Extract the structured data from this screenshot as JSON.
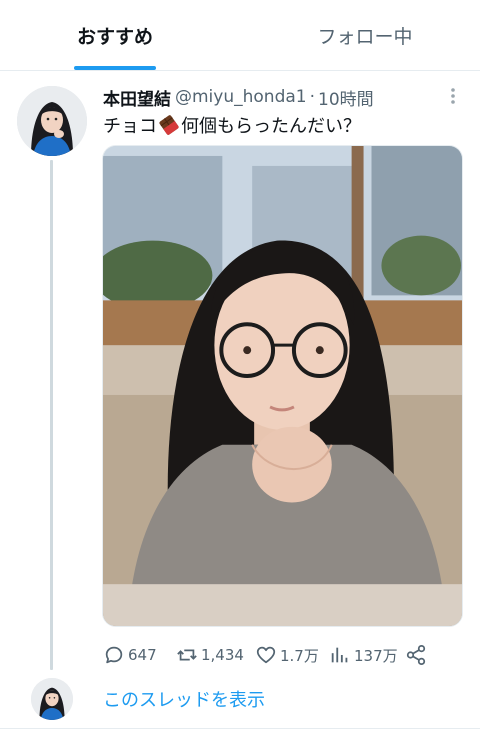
{
  "tabs": [
    {
      "label": "おすすめ",
      "selected": true
    },
    {
      "label": "フォロー中",
      "selected": false
    }
  ],
  "tweet": {
    "display_name": "本田望結",
    "handle": "@miyu_honda1",
    "separator": "·",
    "time": "10時間",
    "text_before_emoji": "チョコ",
    "emoji": "chocolate-bar-emoji",
    "text_after_emoji": "何個もらったんだい？",
    "media": "photo-girl-with-round-glasses",
    "stats": {
      "replies": "647",
      "retweets": "1,434",
      "likes": "1.7万",
      "views": "137万"
    }
  },
  "thread": {
    "show_thread_label": "このスレッドを表示"
  },
  "icons": {
    "more": "more-vertical-icon",
    "reply": "reply-icon",
    "retweet": "retweet-icon",
    "like": "heart-icon",
    "views": "views-chart-icon",
    "share": "share-icon"
  },
  "colors": {
    "accent": "#1d9bf0",
    "text_primary": "#0f1419",
    "text_secondary": "#536471",
    "border": "#e6ecf0"
  }
}
